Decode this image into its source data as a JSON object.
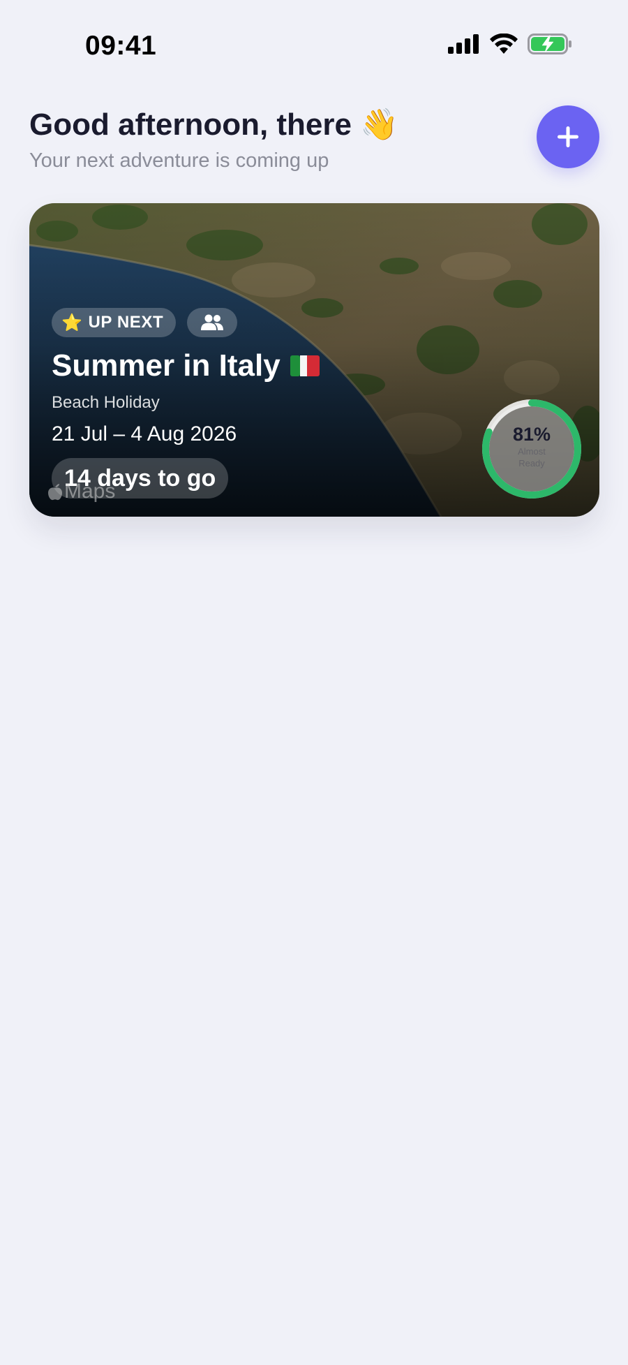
{
  "status_bar": {
    "time": "09:41",
    "icons": [
      "cellular-signal-icon",
      "wifi-icon",
      "battery-charging-icon"
    ]
  },
  "header": {
    "greeting": "Good afternoon, there",
    "greeting_emoji": "👋",
    "subtitle": "Your next adventure is coming up",
    "add_icon": "plus-icon"
  },
  "trip_card": {
    "badge_emoji": "⭐",
    "badge_label": "UP NEXT",
    "group_icon": "people-icon",
    "title": "Summer in Italy",
    "flag_icon": "italy-flag-icon",
    "trip_type": "Beach Holiday",
    "dates": "21 Jul – 4 Aug 2026",
    "countdown": "14 days to go",
    "maps_label": "Maps",
    "progress": {
      "percent": 81,
      "percent_label": "81%",
      "status_label": "Almost Ready"
    }
  },
  "colors": {
    "background": "#F0F1F8",
    "accent": "#6B63F2",
    "progress": "#2DB86A",
    "heading": "#1A1B2E",
    "muted": "#8A8C98"
  }
}
